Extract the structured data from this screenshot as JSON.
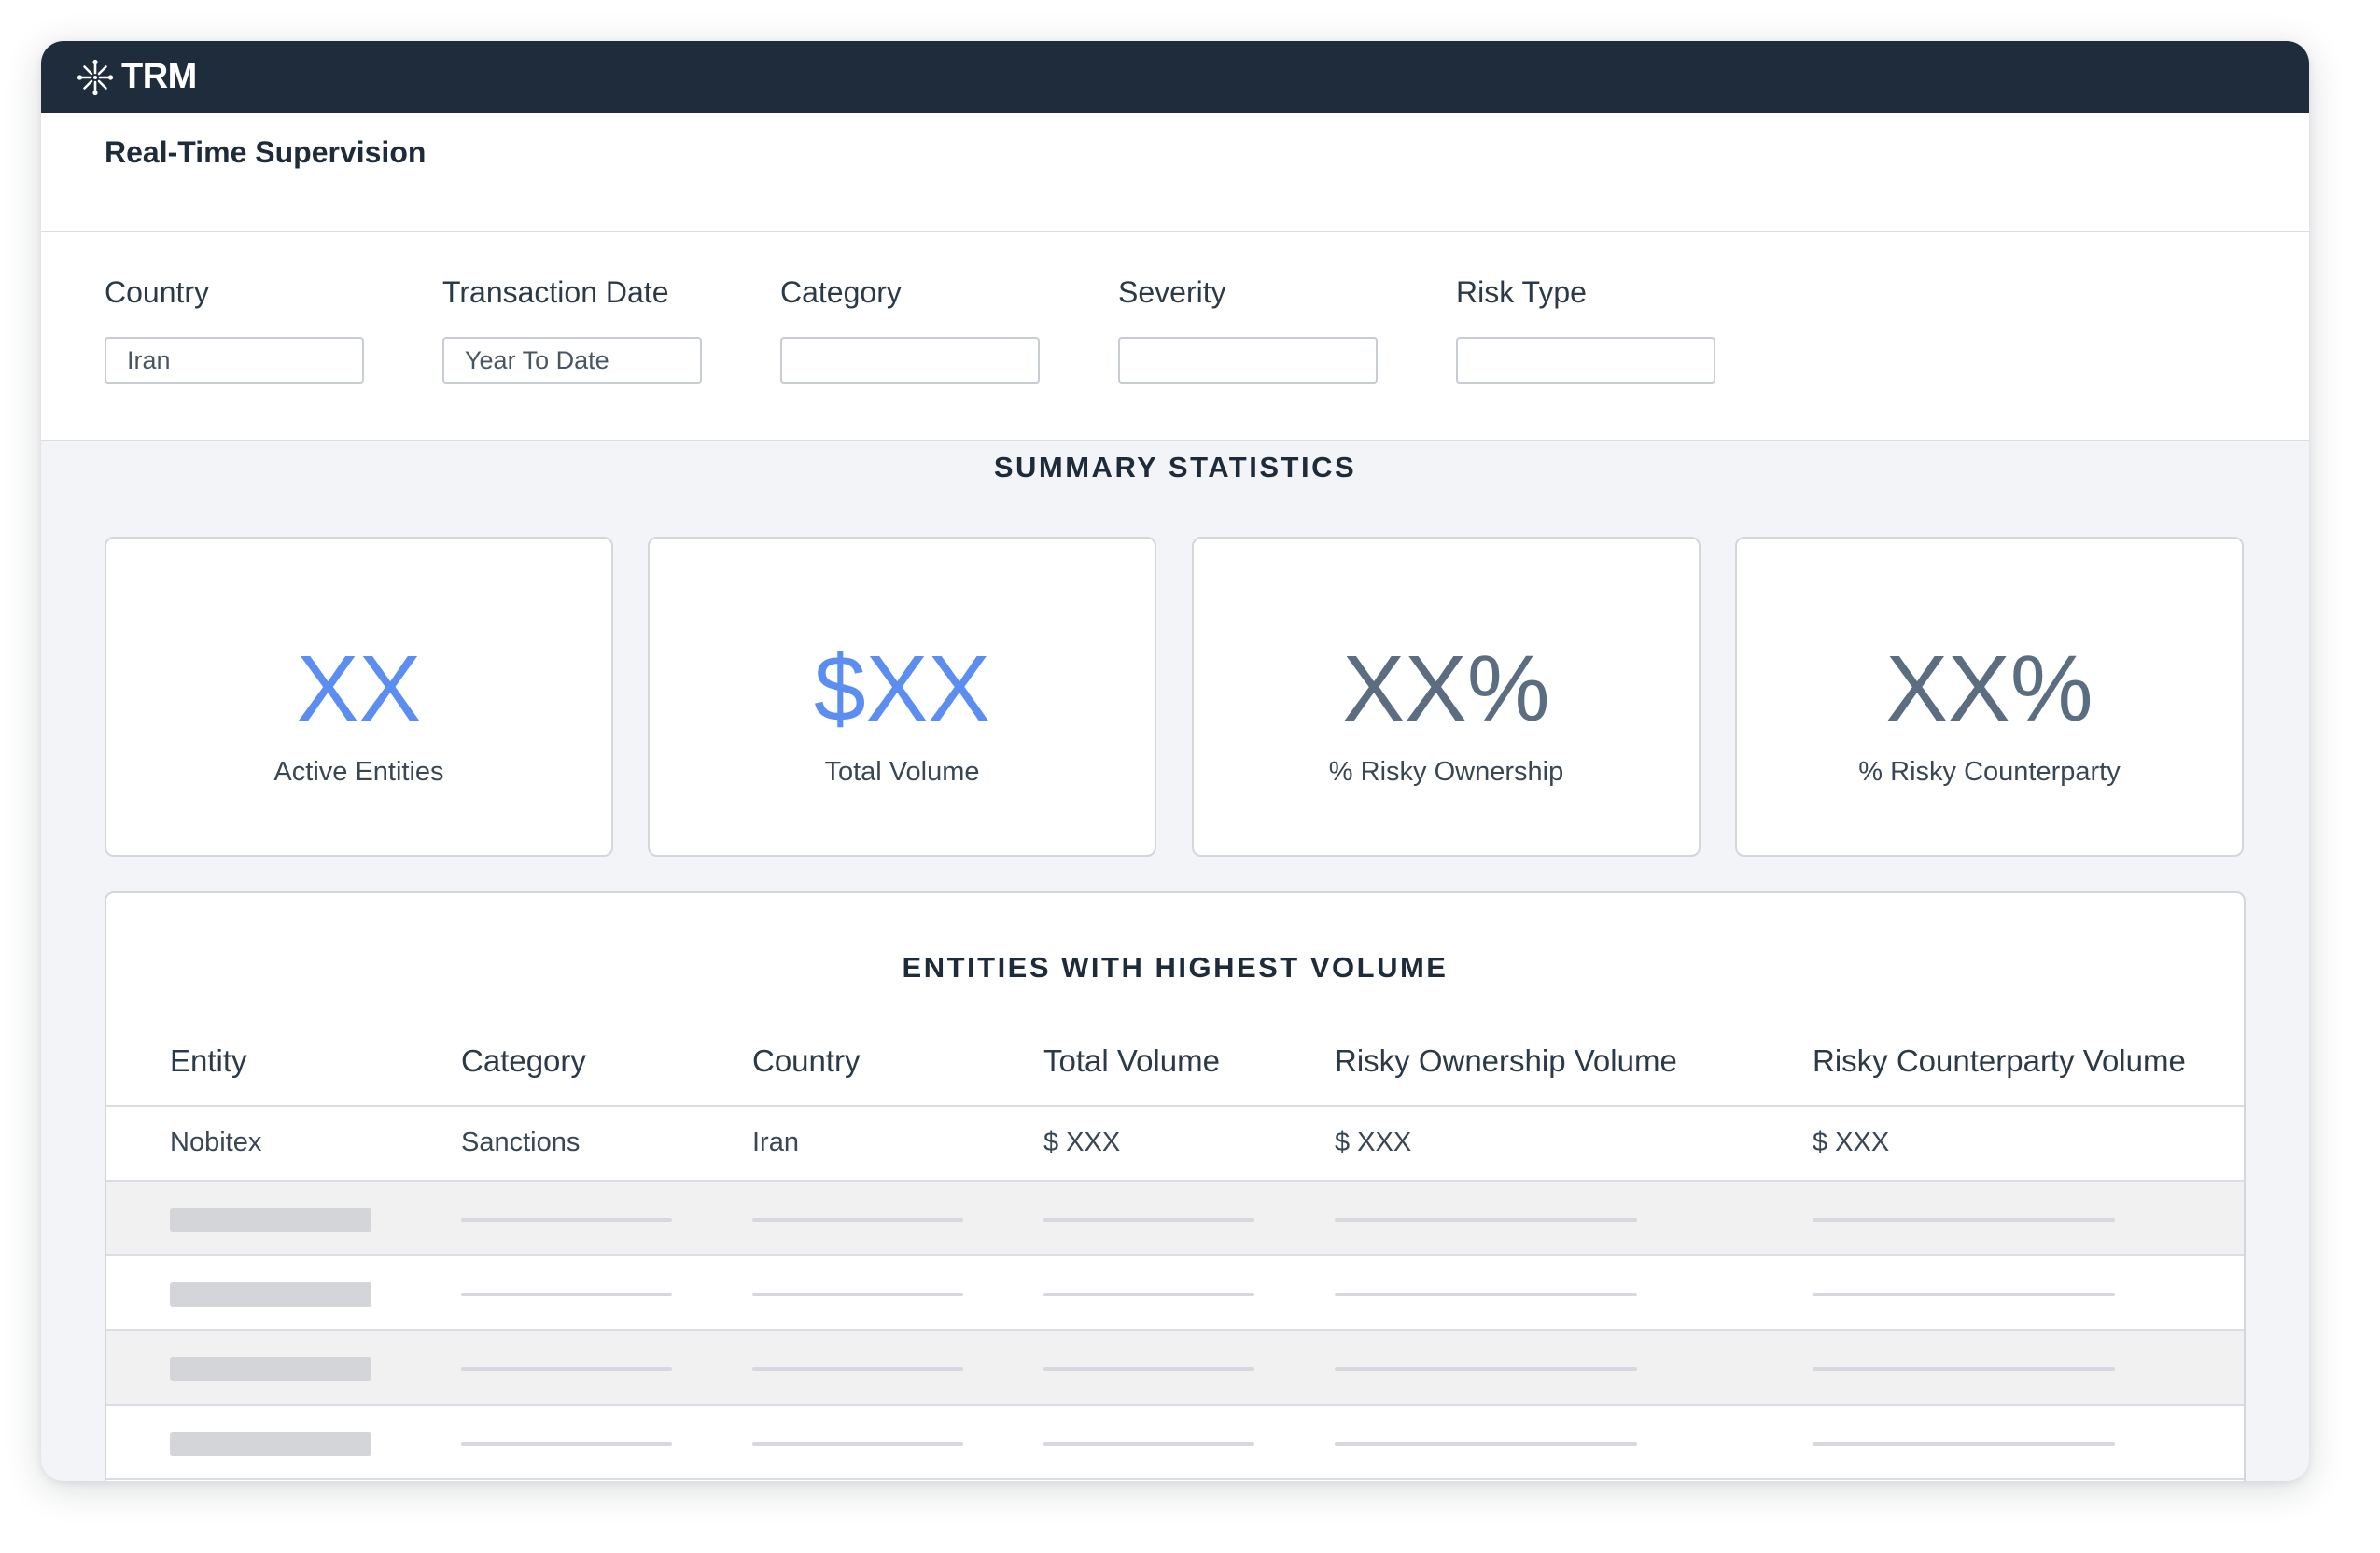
{
  "app": {
    "logo_text": "TRM",
    "logo_icon": "snowflake-icon"
  },
  "page": {
    "title": "Real-Time Supervision"
  },
  "filters": [
    {
      "label": "Country",
      "value": ""
    },
    {
      "label": "Transaction Date",
      "value": ""
    },
    {
      "label": "Category",
      "value": ""
    },
    {
      "label": "Severity",
      "value": ""
    },
    {
      "label": "Risk Type",
      "value": ""
    }
  ],
  "filter_values": {
    "country": "Iran",
    "transaction_date": "Year To Date"
  },
  "summary": {
    "title": "SUMMARY STATISTICS",
    "cards": [
      {
        "value": "XX",
        "label": "Active Entities"
      },
      {
        "value": "$XX",
        "label": "Total Volume"
      },
      {
        "value": "XX%",
        "label": "% Risky Ownership"
      },
      {
        "value": "XX%",
        "label": "% Risky Counterparty"
      }
    ]
  },
  "table": {
    "title": "ENTITIES WITH HIGHEST VOLUME",
    "columns": [
      "Entity",
      "Category",
      "Country",
      "Total Volume",
      "Risky Ownership Volume",
      "Risky Counterparty Volume"
    ],
    "rows": [
      [
        "Nobitex",
        "Sanctions",
        "Iran",
        "$ XXX",
        "$ XXX",
        "$ XXX"
      ]
    ],
    "placeholder_rows": 4
  },
  "colors": {
    "topbar": "#1e2c3b",
    "accent_blue": "#5b8ef0",
    "slate_value": "#5b6d80",
    "page_bg": "#f3f4f7"
  }
}
